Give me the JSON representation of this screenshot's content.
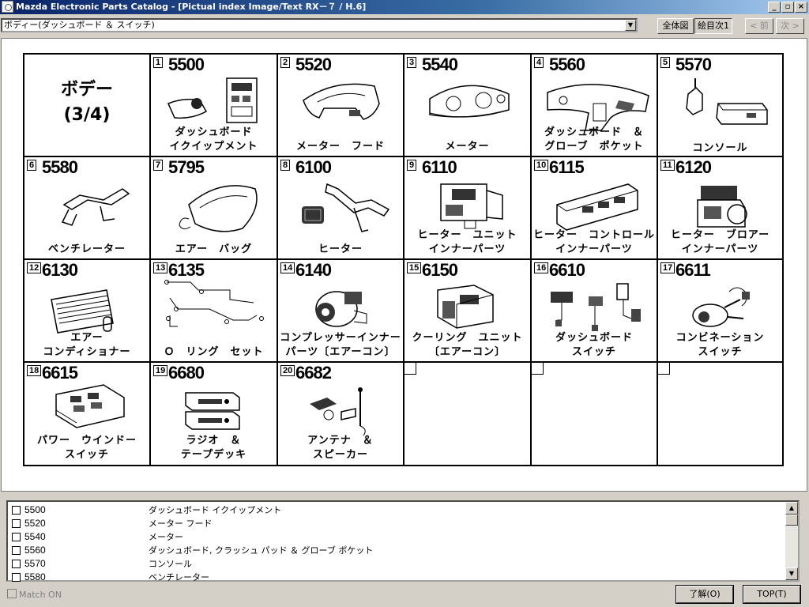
{
  "window": {
    "title": "Mazda Electronic Parts Catalog - [Pictual index Image/Text RX－７ / H.6]",
    "controls": [
      "_",
      "▫",
      "×"
    ]
  },
  "toolbar": {
    "category_value": "ボディー(ダッシュボード ＆ スイッチ)",
    "overall_view_label": "全体図",
    "index_next_label": "絵目次1",
    "prev_label": "< 前",
    "next_label": "次 >"
  },
  "index_page": {
    "title": "ボデー",
    "page": "(3/4)",
    "items": [
      {
        "num": "1",
        "code": "5500",
        "label1": "ダッシュボード",
        "label2": "イクイップメント"
      },
      {
        "num": "2",
        "code": "5520",
        "label1": "",
        "label2": "メーター　フード"
      },
      {
        "num": "3",
        "code": "5540",
        "label1": "",
        "label2": "メーター"
      },
      {
        "num": "4",
        "code": "5560",
        "label1": "ダッシュボード　＆",
        "label2": "グローブ　ポケット"
      },
      {
        "num": "5",
        "code": "5570",
        "label1": "",
        "label2": "コンソール"
      },
      {
        "num": "6",
        "code": "5580",
        "label1": "",
        "label2": "ベンチレーター"
      },
      {
        "num": "7",
        "code": "5795",
        "label1": "",
        "label2": "エアー　バッグ"
      },
      {
        "num": "8",
        "code": "6100",
        "label1": "",
        "label2": "ヒーター"
      },
      {
        "num": "9",
        "code": "6110",
        "label1": "ヒーター　ユニット",
        "label2": "インナーパーツ"
      },
      {
        "num": "10",
        "code": "6115",
        "label1": "ヒーター　コントロール",
        "label2": "インナーパーツ"
      },
      {
        "num": "11",
        "code": "6120",
        "label1": "ヒーター　ブロアー",
        "label2": "インナーパーツ"
      },
      {
        "num": "12",
        "code": "6130",
        "label1": "エアー",
        "label2": "コンディショナー"
      },
      {
        "num": "13",
        "code": "6135",
        "label1": "",
        "label2": "Ｏ　リング　セット"
      },
      {
        "num": "14",
        "code": "6140",
        "label1": "コンプレッサーインナー",
        "label2": "パーツ〔エアーコン〕"
      },
      {
        "num": "15",
        "code": "6150",
        "label1": "クーリング　ユニット",
        "label2": "〔エアーコン〕"
      },
      {
        "num": "16",
        "code": "6610",
        "label1": "ダッシュボード",
        "label2": "スイッチ"
      },
      {
        "num": "17",
        "code": "6611",
        "label1": "コンビネーション",
        "label2": "スイッチ"
      },
      {
        "num": "18",
        "code": "6615",
        "label1": "パワー　ウインドー",
        "label2": "スイッチ"
      },
      {
        "num": "19",
        "code": "6680",
        "label1": "ラジオ　＆",
        "label2": "テープデッキ"
      },
      {
        "num": "20",
        "code": "6682",
        "label1": "アンテナ　＆",
        "label2": "スピーカー"
      }
    ]
  },
  "parts_list": [
    {
      "code": "5500",
      "desc": "ダッシュボード イクイップメント"
    },
    {
      "code": "5520",
      "desc": "メーター フード"
    },
    {
      "code": "5540",
      "desc": "メーター"
    },
    {
      "code": "5560",
      "desc": "ダッシュボード, クラッシュ パッド ＆ グローブ ポケット"
    },
    {
      "code": "5570",
      "desc": "コンソール"
    },
    {
      "code": "5580",
      "desc": "ベンチレーター"
    }
  ],
  "footer": {
    "match_label": "Match ON",
    "ok_label": "了解(O)",
    "top_label": "TOP(T)"
  }
}
